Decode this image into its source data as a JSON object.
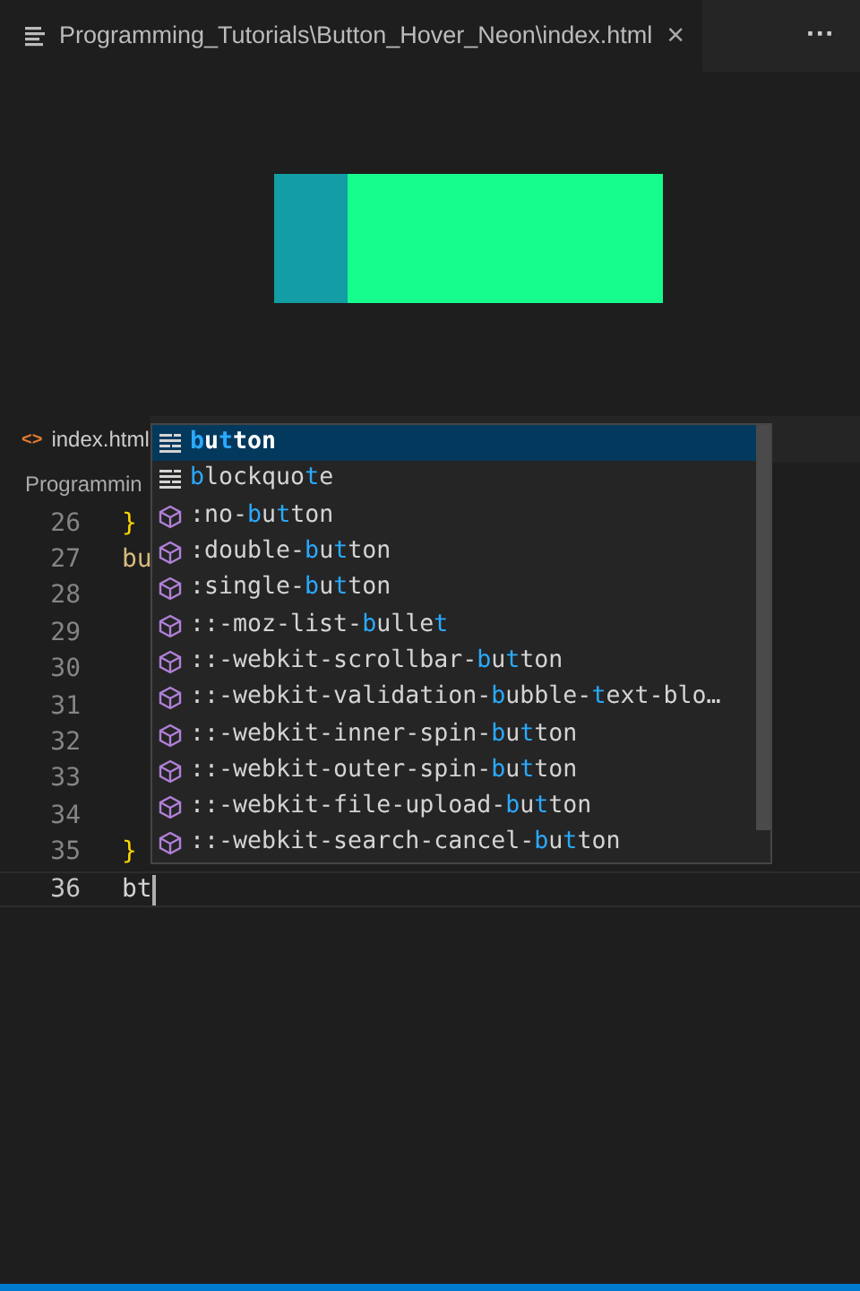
{
  "title_tab": {
    "label": "Programming_Tutorials\\Button_Hover_Neon\\index.html",
    "close": "×",
    "more": "···"
  },
  "editor_tab": {
    "label": "index.html",
    "icon": "<>"
  },
  "breadcrumb": "Programmin",
  "code_lines": [
    {
      "number": "26",
      "text": "}",
      "kind": "brace"
    },
    {
      "number": "27",
      "text": "bu",
      "kind": "selector"
    },
    {
      "number": "28",
      "kind": "blank"
    },
    {
      "number": "29",
      "kind": "blank"
    },
    {
      "number": "30",
      "kind": "blank"
    },
    {
      "number": "31",
      "kind": "blank"
    },
    {
      "number": "32",
      "kind": "blank"
    },
    {
      "number": "33",
      "kind": "blank"
    },
    {
      "number": "34",
      "kind": "blank"
    },
    {
      "number": "35",
      "text": "}",
      "kind": "brace"
    },
    {
      "number": "36",
      "text": "bt",
      "kind": "current"
    }
  ],
  "suggestions": [
    {
      "kind": "keyword",
      "selected": true,
      "parts": [
        {
          "text": "b",
          "match": true
        },
        {
          "text": "u",
          "match": false
        },
        {
          "text": "t",
          "match": true
        },
        {
          "text": "ton",
          "match": false
        }
      ]
    },
    {
      "kind": "keyword",
      "selected": false,
      "parts": [
        {
          "text": "b",
          "match": true
        },
        {
          "text": "lockquo",
          "match": false
        },
        {
          "text": "t",
          "match": true
        },
        {
          "text": "e",
          "match": false
        }
      ]
    },
    {
      "kind": "property",
      "selected": false,
      "parts": [
        {
          "text": ":no-",
          "match": false
        },
        {
          "text": "b",
          "match": true
        },
        {
          "text": "u",
          "match": false
        },
        {
          "text": "t",
          "match": true
        },
        {
          "text": "ton",
          "match": false
        }
      ]
    },
    {
      "kind": "property",
      "selected": false,
      "parts": [
        {
          "text": ":double-",
          "match": false
        },
        {
          "text": "b",
          "match": true
        },
        {
          "text": "u",
          "match": false
        },
        {
          "text": "t",
          "match": true
        },
        {
          "text": "ton",
          "match": false
        }
      ]
    },
    {
      "kind": "property",
      "selected": false,
      "parts": [
        {
          "text": ":single-",
          "match": false
        },
        {
          "text": "b",
          "match": true
        },
        {
          "text": "u",
          "match": false
        },
        {
          "text": "t",
          "match": true
        },
        {
          "text": "ton",
          "match": false
        }
      ]
    },
    {
      "kind": "property",
      "selected": false,
      "parts": [
        {
          "text": "::-moz-list-",
          "match": false
        },
        {
          "text": "b",
          "match": true
        },
        {
          "text": "ulle",
          "match": false
        },
        {
          "text": "t",
          "match": true
        }
      ]
    },
    {
      "kind": "property",
      "selected": false,
      "parts": [
        {
          "text": "::-webkit-scrollbar-",
          "match": false
        },
        {
          "text": "b",
          "match": true
        },
        {
          "text": "u",
          "match": false
        },
        {
          "text": "t",
          "match": true
        },
        {
          "text": "ton",
          "match": false
        }
      ]
    },
    {
      "kind": "property",
      "selected": false,
      "parts": [
        {
          "text": "::-webkit-validation-",
          "match": false
        },
        {
          "text": "b",
          "match": true
        },
        {
          "text": "ubble-",
          "match": false
        },
        {
          "text": "t",
          "match": true
        },
        {
          "text": "ext-blo…",
          "match": false
        }
      ]
    },
    {
      "kind": "property",
      "selected": false,
      "parts": [
        {
          "text": "::-webkit-inner-spin-",
          "match": false
        },
        {
          "text": "b",
          "match": true
        },
        {
          "text": "u",
          "match": false
        },
        {
          "text": "t",
          "match": true
        },
        {
          "text": "ton",
          "match": false
        }
      ]
    },
    {
      "kind": "property",
      "selected": false,
      "parts": [
        {
          "text": "::-webkit-outer-spin-",
          "match": false
        },
        {
          "text": "b",
          "match": true
        },
        {
          "text": "u",
          "match": false
        },
        {
          "text": "t",
          "match": true
        },
        {
          "text": "ton",
          "match": false
        }
      ]
    },
    {
      "kind": "property",
      "selected": false,
      "parts": [
        {
          "text": "::-webkit-file-upload-",
          "match": false
        },
        {
          "text": "b",
          "match": true
        },
        {
          "text": "u",
          "match": false
        },
        {
          "text": "t",
          "match": true
        },
        {
          "text": "ton",
          "match": false
        }
      ]
    },
    {
      "kind": "property",
      "selected": false,
      "parts": [
        {
          "text": "::-webkit-search-cancel-",
          "match": false
        },
        {
          "text": "b",
          "match": true
        },
        {
          "text": "u",
          "match": false
        },
        {
          "text": "t",
          "match": true
        },
        {
          "text": "ton",
          "match": false
        }
      ]
    }
  ]
}
